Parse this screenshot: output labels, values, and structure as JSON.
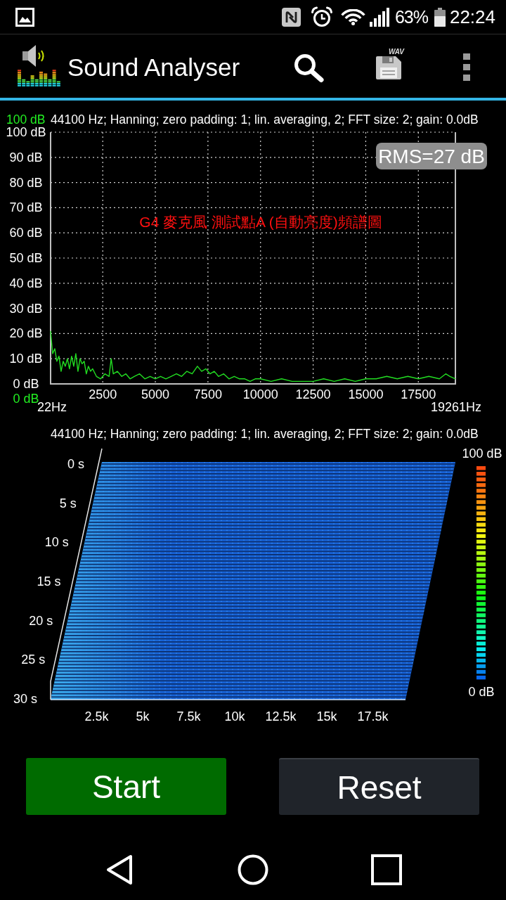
{
  "status_bar": {
    "battery": "63%",
    "time": "22:24"
  },
  "app_bar": {
    "title": "Sound Analyser",
    "save_label": "WAV"
  },
  "spectrum": {
    "range_top": "100 dB",
    "header": "44100 Hz; Hanning; zero padding: 1; lin. averaging, 2; FFT size: 2; gain: 0.0dB",
    "rms": "RMS=27 dB",
    "range_bottom": "0 dB",
    "freq_start": "22Hz",
    "freq_end": "19261Hz",
    "chart_data": {
      "type": "line",
      "title": "G4 麥克風 測試點A (自動亮度)頻譜圖",
      "x": [
        22,
        120,
        220,
        320,
        420,
        520,
        620,
        720,
        820,
        920,
        1020,
        1120,
        1220,
        1320,
        1420,
        1520,
        1620,
        1720,
        1820,
        1920,
        2020,
        2200,
        2400,
        2600,
        2800,
        2900,
        3000,
        3200,
        3400,
        3600,
        3800,
        4000,
        4250,
        4500,
        4750,
        5000,
        5250,
        5500,
        5750,
        6000,
        6250,
        6500,
        6750,
        7000,
        7200,
        7400,
        7600,
        7800,
        8000,
        8250,
        8500,
        8750,
        9000,
        9250,
        9500,
        9750,
        10000,
        10500,
        11000,
        11500,
        12000,
        12500,
        13000,
        13500,
        14000,
        14500,
        15000,
        15500,
        16000,
        16500,
        17000,
        17500,
        18000,
        18500,
        18800,
        19000,
        19261
      ],
      "series": [
        {
          "color": "#22dd22",
          "values": [
            21,
            12,
            14,
            9,
            11,
            5,
            9,
            7,
            10,
            6,
            11,
            7,
            12,
            5,
            10,
            8,
            9,
            4,
            7,
            5,
            6,
            3,
            2,
            4,
            3,
            10,
            4,
            5,
            3,
            4,
            2,
            3,
            4,
            2,
            3,
            2,
            3,
            2,
            3,
            4,
            3,
            5,
            4,
            7,
            5,
            6,
            4,
            5,
            3,
            4,
            2,
            3,
            2,
            2,
            1,
            2,
            2,
            1,
            2,
            1,
            1,
            1,
            2,
            1,
            2,
            1,
            2,
            2,
            3,
            2,
            3,
            2,
            3,
            2,
            4,
            3,
            2
          ]
        }
      ],
      "xlim": [
        22,
        19261
      ],
      "ylim": [
        0,
        100
      ],
      "xticks": [
        2500,
        5000,
        7500,
        10000,
        12500,
        15000,
        17500
      ],
      "yticks": [
        {
          "value": 0,
          "label": "0 dB"
        },
        {
          "value": 10,
          "label": "10 dB"
        },
        {
          "value": 20,
          "label": "20 dB"
        },
        {
          "value": 30,
          "label": "30 dB"
        },
        {
          "value": 40,
          "label": "40 dB"
        },
        {
          "value": 50,
          "label": "50 dB"
        },
        {
          "value": 60,
          "label": "60 dB"
        },
        {
          "value": 70,
          "label": "70 dB"
        },
        {
          "value": 80,
          "label": "80 dB"
        },
        {
          "value": 90,
          "label": "90 dB"
        },
        {
          "value": 100,
          "label": "100 dB"
        }
      ],
      "grid": true
    }
  },
  "spectrogram": {
    "header": "44100 Hz; Hanning; zero padding: 1; lin. averaging, 2; FFT size: 2; gain: 0.0dB",
    "scale_max": "100 dB",
    "scale_min": "0 dB",
    "time_labels": [
      "0 s",
      "5 s",
      "10 s",
      "15 s",
      "20 s",
      "25 s",
      "30 s"
    ],
    "freq_labels": [
      "2.5k",
      "5k",
      "7.5k",
      "10k",
      "12.5k",
      "15k",
      "17.5k"
    ]
  },
  "buttons": [
    {
      "label": "Start",
      "kind": "start"
    },
    {
      "label": "Reset",
      "kind": "reset"
    }
  ]
}
